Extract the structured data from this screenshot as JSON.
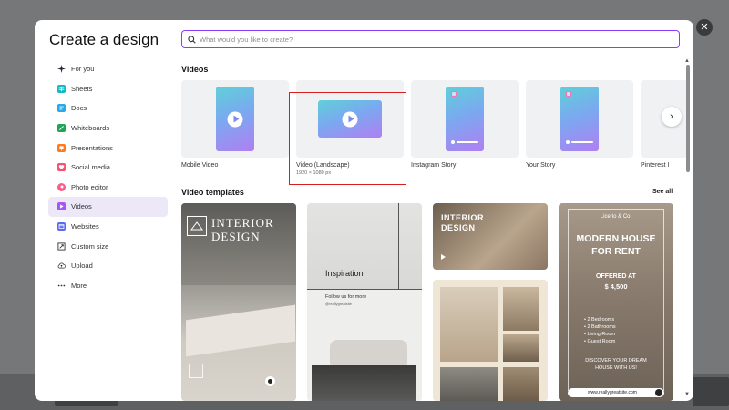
{
  "modal": {
    "title": "Create a design",
    "close_glyph": "✕"
  },
  "search": {
    "placeholder": "What would you like to create?",
    "icon": "search-icon"
  },
  "sidebar": {
    "items": [
      {
        "label": "For you",
        "icon": "sparkle-icon",
        "color": "#1f2937"
      },
      {
        "label": "Sheets",
        "icon": "sheets-icon",
        "color": "#14b8c4"
      },
      {
        "label": "Docs",
        "icon": "docs-icon",
        "color": "#2aa8e6"
      },
      {
        "label": "Whiteboards",
        "icon": "whiteboard-icon",
        "color": "#1fa45a"
      },
      {
        "label": "Presentations",
        "icon": "presentation-icon",
        "color": "#ff7a1a"
      },
      {
        "label": "Social media",
        "icon": "heart-icon",
        "color": "#ff4d6d"
      },
      {
        "label": "Photo editor",
        "icon": "photo-editor-icon",
        "color": "#ff5a8a"
      },
      {
        "label": "Videos",
        "icon": "video-icon",
        "color": "#a855f7",
        "active": true
      },
      {
        "label": "Websites",
        "icon": "website-icon",
        "color": "#5b6cf0"
      },
      {
        "label": "Custom size",
        "icon": "custom-size-icon",
        "color": "#333333"
      },
      {
        "label": "Upload",
        "icon": "upload-icon",
        "color": "#333333"
      },
      {
        "label": "More",
        "icon": "more-icon",
        "color": "#333333"
      }
    ]
  },
  "videos": {
    "title": "Videos",
    "cards": [
      {
        "label": "Mobile Video",
        "sub": ""
      },
      {
        "label": "Video (Landscape)",
        "sub": "1920 × 1080 px"
      },
      {
        "label": "Instagram Story",
        "sub": ""
      },
      {
        "label": "Your Story",
        "sub": ""
      },
      {
        "label": "Pinterest I",
        "sub": ""
      }
    ],
    "next_glyph": "›"
  },
  "templates": {
    "title": "Video templates",
    "see_all": "See all",
    "t1": {
      "line1": "INTERIOR",
      "line2": "DESIGN"
    },
    "t2": {
      "title": "Inspiration",
      "follow": "Follow us for more",
      "handle": "@reallygreatsite"
    },
    "t3": {
      "line1": "INTERIOR",
      "line2": "DESIGN"
    },
    "t5": {
      "brand": "Licerio & Co.",
      "line1": "MODERN HOUSE",
      "line2": "FOR RENT",
      "offered": "OFFERED AT",
      "price": "$ 4,500",
      "features": [
        "2 Bedrooms",
        "2 Bathrooms",
        "Living Room",
        "Guest Room"
      ],
      "cta1": "DISCOVER YOUR DREAM",
      "cta2": "HOUSE WITH US!",
      "url": "www.reallygreatsite.com"
    }
  },
  "colors": {
    "accent": "#8b3dff",
    "highlight": "#d62020"
  }
}
